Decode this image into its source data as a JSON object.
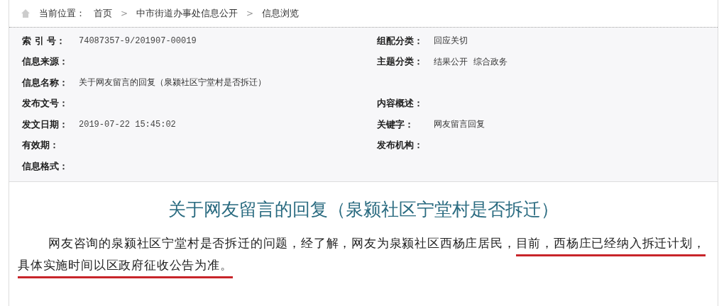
{
  "breadcrumb": {
    "prefix": "当前位置：",
    "items": [
      "首页",
      "中市街道办事处信息公开",
      "信息浏览"
    ],
    "separator": ">"
  },
  "metadata": [
    {
      "left": {
        "label": "索 引 号：",
        "value": "74087357-9/201907-00019",
        "mono": true
      },
      "right": {
        "label": "组配分类：",
        "value": "回应关切"
      }
    },
    {
      "left": {
        "label": "信息来源："
      },
      "right": {
        "label": "主题分类：",
        "value": "结果公开  综合政务"
      }
    },
    {
      "left": {
        "label": "信息名称：",
        "value": "关于网友留言的回复（泉颍社区宁堂村是否拆迁）"
      }
    },
    {
      "left": {
        "label": "发布文号："
      },
      "right": {
        "label": "内容概述："
      }
    },
    {
      "left": {
        "label": "发文日期：",
        "value": "2019-07-22 15:45:02",
        "mono": true
      },
      "right": {
        "label": "关键字：",
        "value": "网友留言回复"
      }
    },
    {
      "left": {
        "label": "有效期："
      },
      "right": {
        "label": "发布机构："
      }
    },
    {
      "left": {
        "label": "信息格式："
      }
    }
  ],
  "article": {
    "title": "关于网友留言的回复（泉颍社区宁堂村是否拆迁）",
    "body": [
      {
        "text": "网友咨询的泉颍社区宁堂村是否拆迁的问题，经了解，网友为泉颍社区西杨庄居民，",
        "underlined": false
      },
      {
        "text": "目前，西杨庄已经纳入拆迁计划，具体实施时间以区政府征收公告为准。",
        "underlined": true
      }
    ]
  }
}
